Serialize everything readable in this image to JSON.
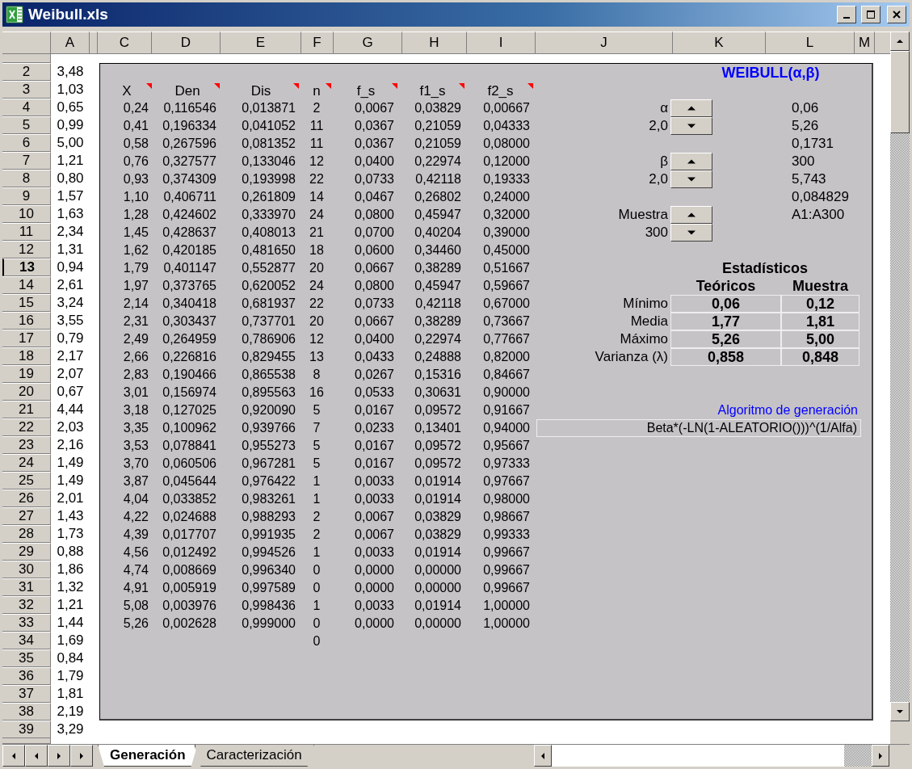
{
  "window": {
    "title": "Weibull.xls"
  },
  "column_headers": [
    "A",
    "C",
    "D",
    "E",
    "F",
    "G",
    "H",
    "I",
    "J",
    "K",
    "L",
    "M"
  ],
  "rows": [
    {
      "number": "2",
      "value": "3,48",
      "selected": false
    },
    {
      "number": "3",
      "value": "1,03",
      "selected": false
    },
    {
      "number": "4",
      "value": "0,65",
      "selected": false
    },
    {
      "number": "5",
      "value": "0,99",
      "selected": false
    },
    {
      "number": "6",
      "value": "5,00",
      "selected": false
    },
    {
      "number": "7",
      "value": "1,21",
      "selected": false
    },
    {
      "number": "8",
      "value": "0,80",
      "selected": false
    },
    {
      "number": "9",
      "value": "1,57",
      "selected": false
    },
    {
      "number": "10",
      "value": "1,63",
      "selected": false
    },
    {
      "number": "11",
      "value": "2,34",
      "selected": false
    },
    {
      "number": "12",
      "value": "1,31",
      "selected": false
    },
    {
      "number": "13",
      "value": "0,94",
      "selected": true
    },
    {
      "number": "14",
      "value": "2,61",
      "selected": false
    },
    {
      "number": "15",
      "value": "3,24",
      "selected": false
    },
    {
      "number": "16",
      "value": "3,55",
      "selected": false
    },
    {
      "number": "17",
      "value": "0,79",
      "selected": false
    },
    {
      "number": "18",
      "value": "2,17",
      "selected": false
    },
    {
      "number": "19",
      "value": "2,07",
      "selected": false
    },
    {
      "number": "20",
      "value": "0,67",
      "selected": false
    },
    {
      "number": "21",
      "value": "4,44",
      "selected": false
    },
    {
      "number": "22",
      "value": "2,03",
      "selected": false
    },
    {
      "number": "23",
      "value": "2,16",
      "selected": false
    },
    {
      "number": "24",
      "value": "1,49",
      "selected": false
    },
    {
      "number": "25",
      "value": "1,49",
      "selected": false
    },
    {
      "number": "26",
      "value": "2,01",
      "selected": false
    },
    {
      "number": "27",
      "value": "1,43",
      "selected": false
    },
    {
      "number": "28",
      "value": "1,73",
      "selected": false
    },
    {
      "number": "29",
      "value": "0,88",
      "selected": false
    },
    {
      "number": "30",
      "value": "1,86",
      "selected": false
    },
    {
      "number": "31",
      "value": "1,32",
      "selected": false
    },
    {
      "number": "32",
      "value": "1,21",
      "selected": false
    },
    {
      "number": "33",
      "value": "1,44",
      "selected": false
    },
    {
      "number": "34",
      "value": "1,69",
      "selected": false
    },
    {
      "number": "35",
      "value": "0,84",
      "selected": false
    },
    {
      "number": "36",
      "value": "1,79",
      "selected": false
    },
    {
      "number": "37",
      "value": "1,81",
      "selected": false
    },
    {
      "number": "38",
      "value": "2,19",
      "selected": false
    },
    {
      "number": "39",
      "value": "3,29",
      "selected": false
    }
  ],
  "table": {
    "columns": [
      {
        "label": "X",
        "has_comment": true
      },
      {
        "label": "Den",
        "has_comment": true
      },
      {
        "label": "Dis",
        "has_comment": true
      },
      {
        "label": "n",
        "has_comment": true
      },
      {
        "label": "f_s",
        "has_comment": true
      },
      {
        "label": "f1_s",
        "has_comment": true
      },
      {
        "label": "f2_s",
        "has_comment": true
      }
    ],
    "rows": [
      [
        "0,24",
        "0,116546",
        "0,013871",
        "2",
        "0,0067",
        "0,03829",
        "0,00667"
      ],
      [
        "0,41",
        "0,196334",
        "0,041052",
        "11",
        "0,0367",
        "0,21059",
        "0,04333"
      ],
      [
        "0,58",
        "0,267596",
        "0,081352",
        "11",
        "0,0367",
        "0,21059",
        "0,08000"
      ],
      [
        "0,76",
        "0,327577",
        "0,133046",
        "12",
        "0,0400",
        "0,22974",
        "0,12000"
      ],
      [
        "0,93",
        "0,374309",
        "0,193998",
        "22",
        "0,0733",
        "0,42118",
        "0,19333"
      ],
      [
        "1,10",
        "0,406711",
        "0,261809",
        "14",
        "0,0467",
        "0,26802",
        "0,24000"
      ],
      [
        "1,28",
        "0,424602",
        "0,333970",
        "24",
        "0,0800",
        "0,45947",
        "0,32000"
      ],
      [
        "1,45",
        "0,428637",
        "0,408013",
        "21",
        "0,0700",
        "0,40204",
        "0,39000"
      ],
      [
        "1,62",
        "0,420185",
        "0,481650",
        "18",
        "0,0600",
        "0,34460",
        "0,45000"
      ],
      [
        "1,79",
        "0,401147",
        "0,552877",
        "20",
        "0,0667",
        "0,38289",
        "0,51667"
      ],
      [
        "1,97",
        "0,373765",
        "0,620052",
        "24",
        "0,0800",
        "0,45947",
        "0,59667"
      ],
      [
        "2,14",
        "0,340418",
        "0,681937",
        "22",
        "0,0733",
        "0,42118",
        "0,67000"
      ],
      [
        "2,31",
        "0,303437",
        "0,737701",
        "20",
        "0,0667",
        "0,38289",
        "0,73667"
      ],
      [
        "2,49",
        "0,264959",
        "0,786906",
        "12",
        "0,0400",
        "0,22974",
        "0,77667"
      ],
      [
        "2,66",
        "0,226816",
        "0,829455",
        "13",
        "0,0433",
        "0,24888",
        "0,82000"
      ],
      [
        "2,83",
        "0,190466",
        "0,865538",
        "8",
        "0,0267",
        "0,15316",
        "0,84667"
      ],
      [
        "3,01",
        "0,156974",
        "0,895563",
        "16",
        "0,0533",
        "0,30631",
        "0,90000"
      ],
      [
        "3,18",
        "0,127025",
        "0,920090",
        "5",
        "0,0167",
        "0,09572",
        "0,91667"
      ],
      [
        "3,35",
        "0,100962",
        "0,939766",
        "7",
        "0,0233",
        "0,13401",
        "0,94000"
      ],
      [
        "3,53",
        "0,078841",
        "0,955273",
        "5",
        "0,0167",
        "0,09572",
        "0,95667"
      ],
      [
        "3,70",
        "0,060506",
        "0,967281",
        "5",
        "0,0167",
        "0,09572",
        "0,97333"
      ],
      [
        "3,87",
        "0,045644",
        "0,976422",
        "1",
        "0,0033",
        "0,01914",
        "0,97667"
      ],
      [
        "4,04",
        "0,033852",
        "0,983261",
        "1",
        "0,0033",
        "0,01914",
        "0,98000"
      ],
      [
        "4,22",
        "0,024688",
        "0,988293",
        "2",
        "0,0067",
        "0,03829",
        "0,98667"
      ],
      [
        "4,39",
        "0,017707",
        "0,991935",
        "2",
        "0,0067",
        "0,03829",
        "0,99333"
      ],
      [
        "4,56",
        "0,012492",
        "0,994526",
        "1",
        "0,0033",
        "0,01914",
        "0,99667"
      ],
      [
        "4,74",
        "0,008669",
        "0,996340",
        "0",
        "0,0000",
        "0,00000",
        "0,99667"
      ],
      [
        "4,91",
        "0,005919",
        "0,997589",
        "0",
        "0,0000",
        "0,00000",
        "0,99667"
      ],
      [
        "5,08",
        "0,003976",
        "0,998436",
        "1",
        "0,0033",
        "0,01914",
        "1,00000"
      ],
      [
        "5,26",
        "0,002628",
        "0,999000",
        "0",
        "0,0000",
        "0,00000",
        "1,00000"
      ]
    ],
    "trailing_n": "0"
  },
  "weibull": {
    "title": "WEIBULL(α,β)",
    "spinners": [
      {
        "label": "α",
        "value": "2,0"
      },
      {
        "label": "β",
        "value": "2,0"
      },
      {
        "label": "Muestra",
        "value": "300"
      }
    ],
    "values": [
      "0,06",
      "5,26",
      "0,1731",
      "300",
      "5,743",
      "0,084829",
      "A1:A300"
    ]
  },
  "statistics": {
    "title": "Estadísticos",
    "columns": [
      "Teóricos",
      "Muestra"
    ],
    "rows": [
      {
        "label": "Mínimo",
        "teoricos": "0,06",
        "muestra": "0,12"
      },
      {
        "label": "Media",
        "teoricos": "1,77",
        "muestra": "1,81"
      },
      {
        "label": "Máximo",
        "teoricos": "5,26",
        "muestra": "5,00"
      },
      {
        "label": "Varianza (λ)",
        "teoricos": "0,858",
        "muestra": "0,848"
      }
    ]
  },
  "algorithm": {
    "label": "Algoritmo de generación",
    "formula": "Beta*(-LN(1-ALEATORIO()))^(1/Alfa)"
  },
  "sheet_tabs": [
    {
      "label": "Generación",
      "selected": true
    },
    {
      "label": "Caracterización",
      "selected": false
    }
  ]
}
